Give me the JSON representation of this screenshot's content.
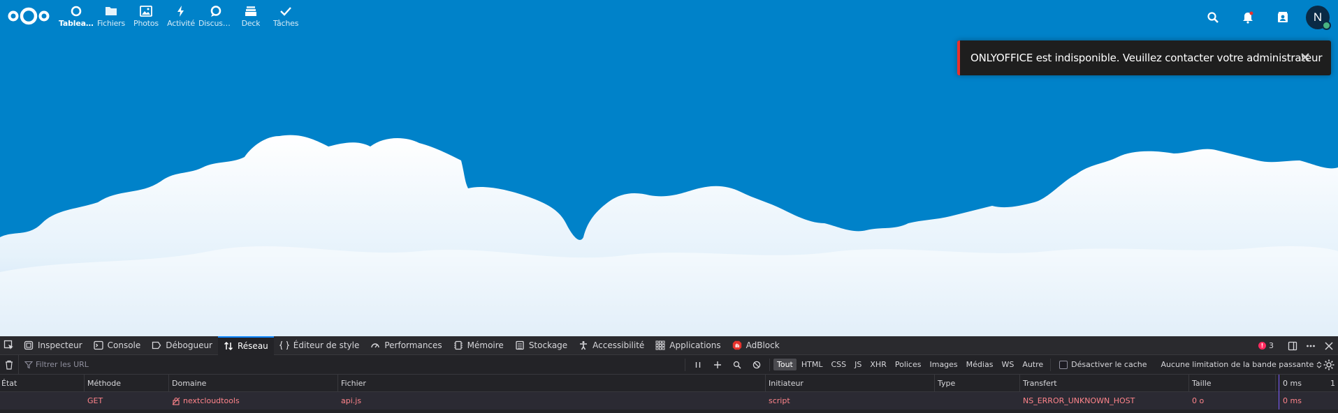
{
  "header": {
    "apps": [
      {
        "label": "Tableau...",
        "icon": "dashboard-icon",
        "active": true
      },
      {
        "label": "Fichiers",
        "icon": "folder-icon"
      },
      {
        "label": "Photos",
        "icon": "image-icon"
      },
      {
        "label": "Activité",
        "icon": "lightning-icon"
      },
      {
        "label": "Discuss...",
        "icon": "talk-icon"
      },
      {
        "label": "Deck",
        "icon": "deck-icon"
      },
      {
        "label": "Tâches",
        "icon": "check-icon"
      }
    ],
    "avatar_initial": "N",
    "right_icons": [
      "search-icon",
      "notifications-icon",
      "contacts-icon"
    ]
  },
  "toast": {
    "message": "ONLYOFFICE est indisponible. Veuillez contacter votre administrateur",
    "accent_color": "#e9322d"
  },
  "devtools": {
    "tabs": [
      {
        "label": "Inspecteur",
        "icon": "inspector-icon"
      },
      {
        "label": "Console",
        "icon": "console-icon"
      },
      {
        "label": "Débogueur",
        "icon": "debugger-icon"
      },
      {
        "label": "Réseau",
        "icon": "network-icon",
        "active": true
      },
      {
        "label": "Éditeur de style",
        "icon": "style-editor-icon"
      },
      {
        "label": "Performances",
        "icon": "performance-icon"
      },
      {
        "label": "Mémoire",
        "icon": "memory-icon"
      },
      {
        "label": "Stockage",
        "icon": "storage-icon"
      },
      {
        "label": "Accessibilité",
        "icon": "accessibility-icon"
      },
      {
        "label": "Applications",
        "icon": "applications-icon"
      },
      {
        "label": "AdBlock",
        "icon": "adblock-icon"
      }
    ],
    "error_count": "3",
    "filter_placeholder": "Filtrer les URL",
    "type_filters": [
      "Tout",
      "HTML",
      "CSS",
      "JS",
      "XHR",
      "Polices",
      "Images",
      "Médias",
      "WS",
      "Autre"
    ],
    "disable_cache_label": "Désactiver le cache",
    "throttle_label": "Aucune limitation de la bande passante",
    "columns": [
      "État",
      "Méthode",
      "Domaine",
      "Fichier",
      "Initiateur",
      "Type",
      "Transfert",
      "Taille"
    ],
    "waterfall_label_0": "0 ms",
    "waterfall_label_1": "1",
    "rows": [
      {
        "etat": "",
        "methode": "GET",
        "domaine": "nextcloudtools",
        "fichier": "api.js",
        "initiateur": "script",
        "type": "",
        "transfert": "NS_ERROR_UNKNOWN_HOST",
        "taille": "0 o",
        "waterfall": "0 ms"
      }
    ],
    "accent_color": "#0a84ff",
    "error_color": "#ff848b"
  }
}
